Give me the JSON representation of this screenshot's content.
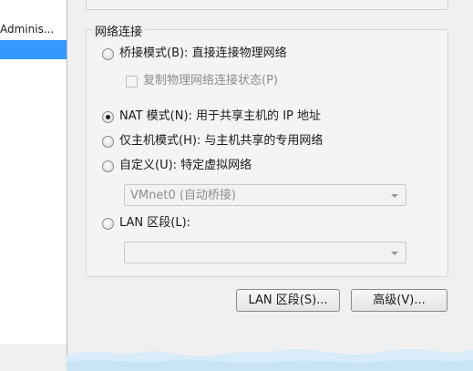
{
  "left_pane": {
    "items": [
      {
        "label": "Adminis..."
      },
      {
        "label": ""
      }
    ]
  },
  "network_group": {
    "title": "网络连接",
    "bridged": {
      "label": "桥接模式(B): 直接连接物理网络",
      "selected": false
    },
    "replicate": {
      "label": "复制物理网络连接状态(P)",
      "checked": false,
      "enabled": false
    },
    "nat": {
      "label": "NAT 模式(N): 用于共享主机的 IP 地址",
      "selected": true
    },
    "host_only": {
      "label": "仅主机模式(H): 与主机共享的专用网络",
      "selected": false
    },
    "custom": {
      "label": "自定义(U): 特定虚拟网络",
      "selected": false
    },
    "custom_select": {
      "value": "VMnet0 (自动桥接)",
      "enabled": false
    },
    "lan_segment": {
      "label": "LAN 区段(L):",
      "selected": false
    },
    "lan_select": {
      "value": "",
      "enabled": false
    }
  },
  "buttons": {
    "lan_segments": "LAN 区段(S)...",
    "advanced": "高级(V)..."
  },
  "colors": {
    "selection": "#3399ff",
    "background": "#f0f0f0",
    "wave": "#c9e4f7"
  }
}
